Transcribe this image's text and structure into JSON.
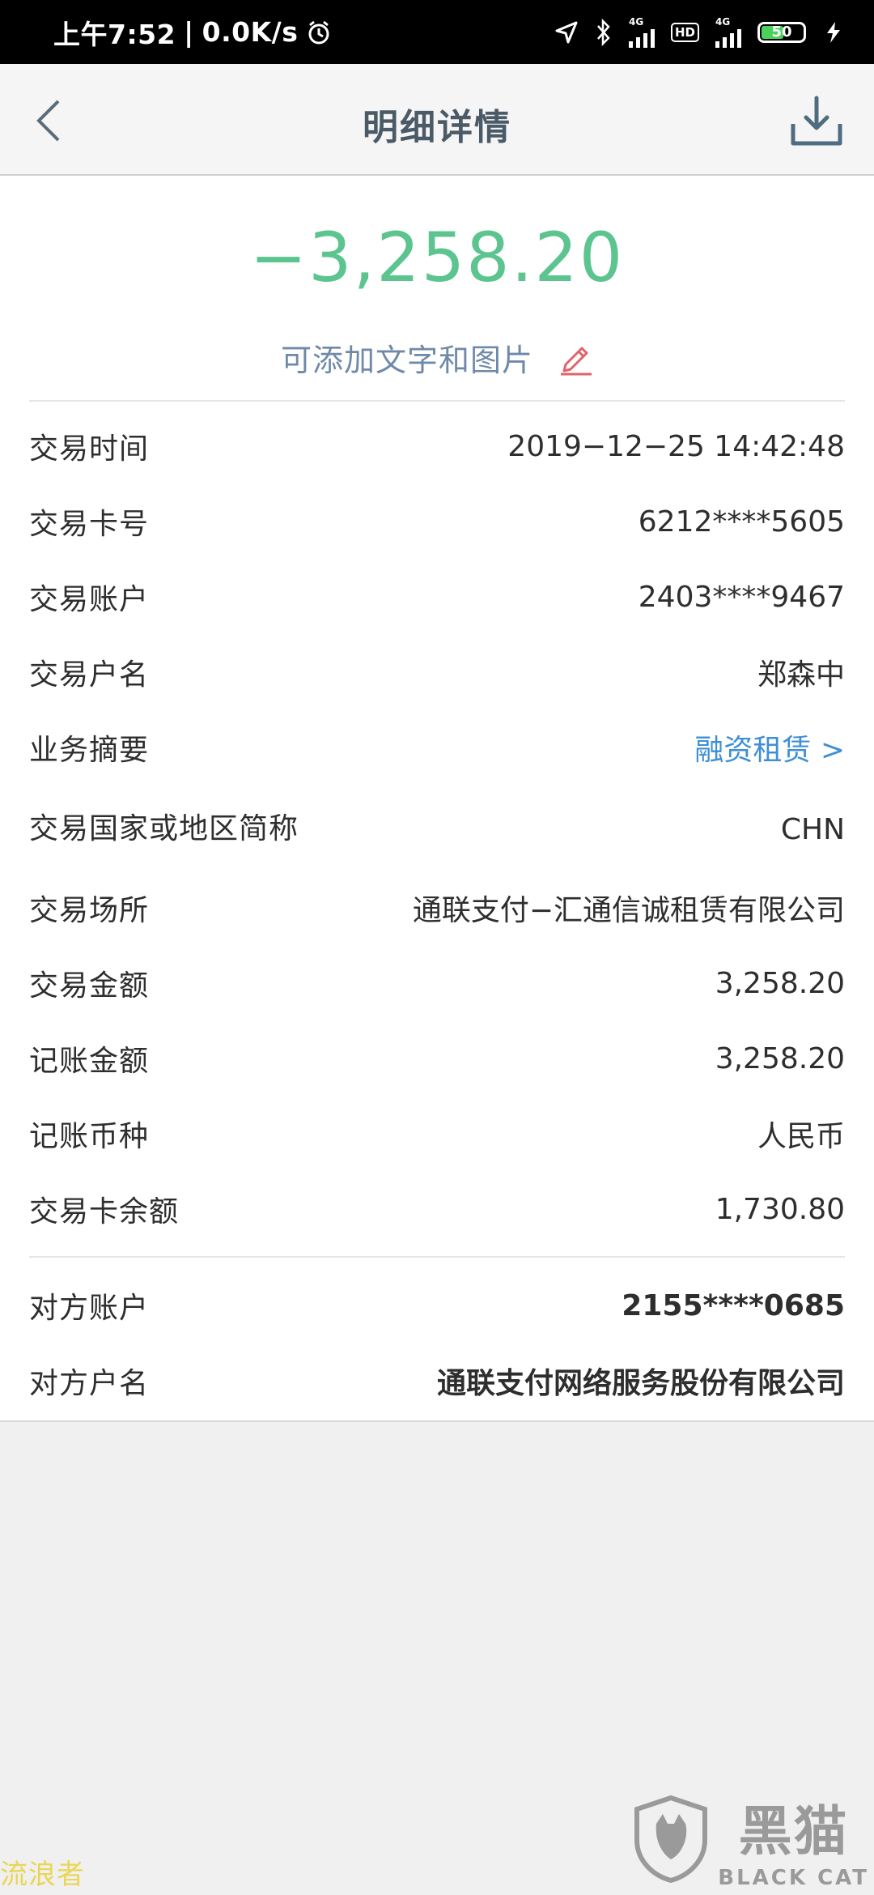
{
  "status_bar": {
    "time": "上午7:52",
    "speed": "0.0K/s",
    "net1": "4G",
    "hd": "HD",
    "net2": "4G",
    "battery": "50"
  },
  "header": {
    "title": "明细详情"
  },
  "summary": {
    "amount": "−3,258.20",
    "note_prompt": "可添加文字和图片"
  },
  "details": [
    {
      "label": "交易时间",
      "value": "2019−12−25 14:42:48"
    },
    {
      "label": "交易卡号",
      "value": "6212****5605"
    },
    {
      "label": "交易账户",
      "value": "2403****9467"
    },
    {
      "label": "交易户名",
      "value": "郑森中"
    },
    {
      "label": "业务摘要",
      "value": "融资租赁 >"
    },
    {
      "label": "交易国家或地区简称",
      "value": "CHN"
    },
    {
      "label": "交易场所",
      "value": "通联支付−汇通信诚租赁有限公司"
    },
    {
      "label": "交易金额",
      "value": "3,258.20"
    },
    {
      "label": "记账金额",
      "value": "3,258.20"
    },
    {
      "label": "记账币种",
      "value": "人民币"
    },
    {
      "label": "交易卡余额",
      "value": "1,730.80"
    }
  ],
  "counterparty": [
    {
      "label": "对方账户",
      "value": "2155****0685"
    },
    {
      "label": "对方户名",
      "value": "通联支付网络服务股份有限公司"
    }
  ],
  "watermarks": {
    "left": "流浪者",
    "brand_cn": "黑猫",
    "brand_en": "BLACK CAT"
  },
  "colors": {
    "amount": "#5cc48f",
    "link": "#3e8fd6",
    "note": "#6f8aa8",
    "edit_icon": "#e2626a"
  }
}
